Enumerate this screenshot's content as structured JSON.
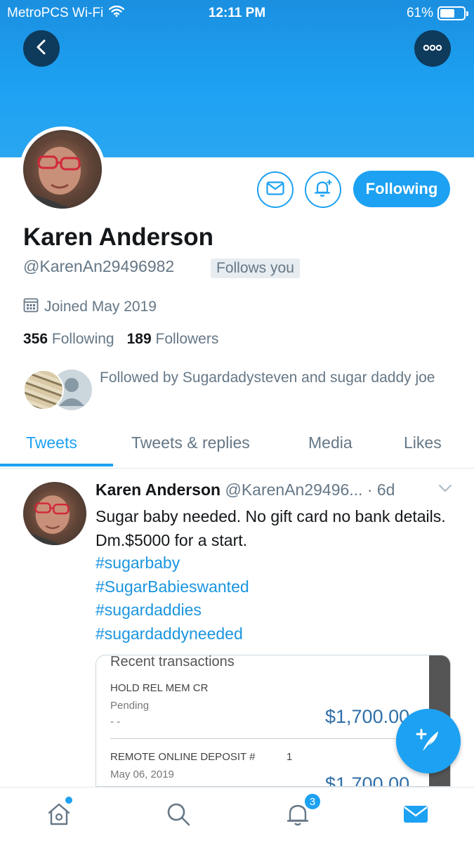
{
  "status_bar": {
    "carrier": "MetroPCS Wi-Fi",
    "time": "12:11 PM",
    "battery_percent": "61%",
    "battery_level": 0.61
  },
  "header": {
    "back_icon": "chevron-left-icon",
    "more_icon": "more-dots-icon"
  },
  "profile": {
    "name": "Karen Anderson",
    "handle": "@KarenAn29496982",
    "follows_you": "Follows you",
    "joined": "Joined May 2019",
    "following_count": "356",
    "following_label": "Following",
    "followers_count": "189",
    "followers_label": "Followers",
    "followed_by": "Followed by Sugardadysteven and sugar daddy joe",
    "following_button": "Following"
  },
  "tabs": [
    {
      "label": "Tweets",
      "active": true
    },
    {
      "label": "Tweets & replies",
      "active": false
    },
    {
      "label": "Media",
      "active": false
    },
    {
      "label": "Likes",
      "active": false
    }
  ],
  "tweet": {
    "name": "Karen Anderson",
    "meta": "@KarenAn29496... · 6d",
    "text": "Sugar baby needed. No gift card no bank details. Dm.$5000 for a start.",
    "hashtags": [
      "#sugarbaby",
      "#SugarBabieswanted",
      "#sugardaddies",
      "#sugardaddyneeded"
    ],
    "media": {
      "title": "Recent transactions",
      "row1_label": "HOLD REL MEM CR",
      "row1_status": "Pending",
      "row1_sub": "- -",
      "row1_amount": "$1,700.00",
      "row2_label": "REMOTE ONLINE DEPOSIT #",
      "row2_num": "1",
      "row2_date": "May 06, 2019",
      "row2_amount": "$1,700.00"
    }
  },
  "bottom_nav": {
    "notifications_badge": "3"
  },
  "colors": {
    "accent": "#1da1f2",
    "banner": "#1da1f2",
    "muted": "#657786"
  }
}
